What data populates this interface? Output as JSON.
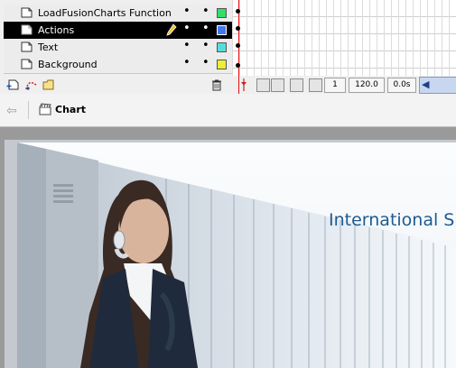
{
  "timeline": {
    "layers": [
      {
        "name": "LoadFusionCharts Function",
        "color": "#33dd66",
        "selected": false,
        "editing": false
      },
      {
        "name": "Actions",
        "color": "#4477ee",
        "selected": true,
        "editing": true
      },
      {
        "name": "Text",
        "color": "#55dddd",
        "selected": false,
        "editing": false
      },
      {
        "name": "Background",
        "color": "#eeee33",
        "selected": false,
        "editing": false
      }
    ],
    "frame_number": "1",
    "frame_rate": "120.0 fps",
    "elapsed_time": "0.0s"
  },
  "edit_bar": {
    "scene_label": "Chart"
  },
  "stage": {
    "title_text": "International S"
  },
  "colors": {
    "playhead": "#e01010",
    "selected_row": "#000000",
    "stage_title": "#1d5b91"
  },
  "icons": [
    "layer-page-icon",
    "pencil-icon",
    "visibility-dot-icon",
    "lock-dot-icon",
    "add-layer-icon",
    "add-guide-icon",
    "add-folder-icon",
    "trash-icon",
    "back-arrow-icon",
    "scene-icon"
  ]
}
